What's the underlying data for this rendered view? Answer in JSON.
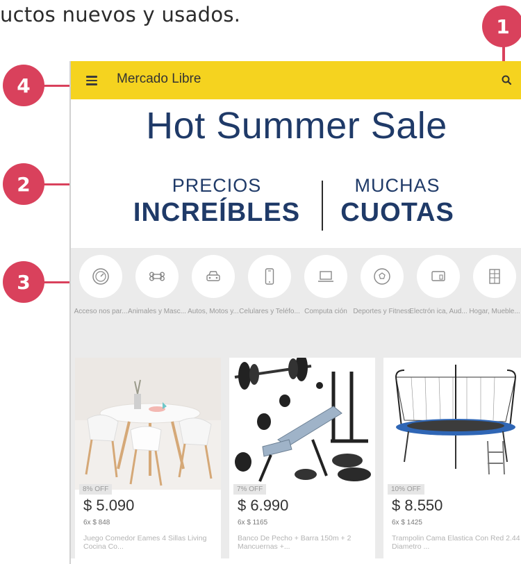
{
  "caption": "uctos nuevos y usados.",
  "badges": [
    "1",
    "2",
    "3",
    "4"
  ],
  "topbar": {
    "brand": "Mercado Libre",
    "color": "#f5d31f"
  },
  "hero": {
    "title": "Hot Summer Sale",
    "left_small": "PRECIOS",
    "left_big": "INCREÍBLES",
    "right_small": "MUCHAS",
    "right_big": "CUOTAS",
    "color": "#1f3a68"
  },
  "categories": [
    {
      "label": "Acceso nos par...",
      "icon": "speedometer-icon"
    },
    {
      "label": "Animales y Masc...",
      "icon": "bone-icon"
    },
    {
      "label": "Autos, Motos y...",
      "icon": "car-icon"
    },
    {
      "label": "Celulares y Teléfo...",
      "icon": "phone-icon"
    },
    {
      "label": "Computa ción",
      "icon": "laptop-icon"
    },
    {
      "label": "Deportes y Fitness",
      "icon": "soccer-ball-icon"
    },
    {
      "label": "Electrón ica, Aud...",
      "icon": "tv-icon"
    },
    {
      "label": "Hogar, Mueble...",
      "icon": "cabinet-icon"
    }
  ],
  "products": [
    {
      "off": "8% OFF",
      "price": "$ 5.090",
      "installments": "6x $ 848",
      "title": "Juego Comedor Eames 4 Sillas Living Cocina Co...",
      "image": "dining-set-image"
    },
    {
      "off": "7% OFF",
      "price": "$ 6.990",
      "installments": "6x $ 1165",
      "title": "Banco De Pecho + Barra 150m + 2 Mancuernas +...",
      "image": "weight-bench-image"
    },
    {
      "off": "10% OFF",
      "price": "$ 8.550",
      "installments": "6x $ 1425",
      "title": "Trampolin Cama Elastica Con Red 2.44 Diametro ...",
      "image": "trampoline-image"
    }
  ]
}
